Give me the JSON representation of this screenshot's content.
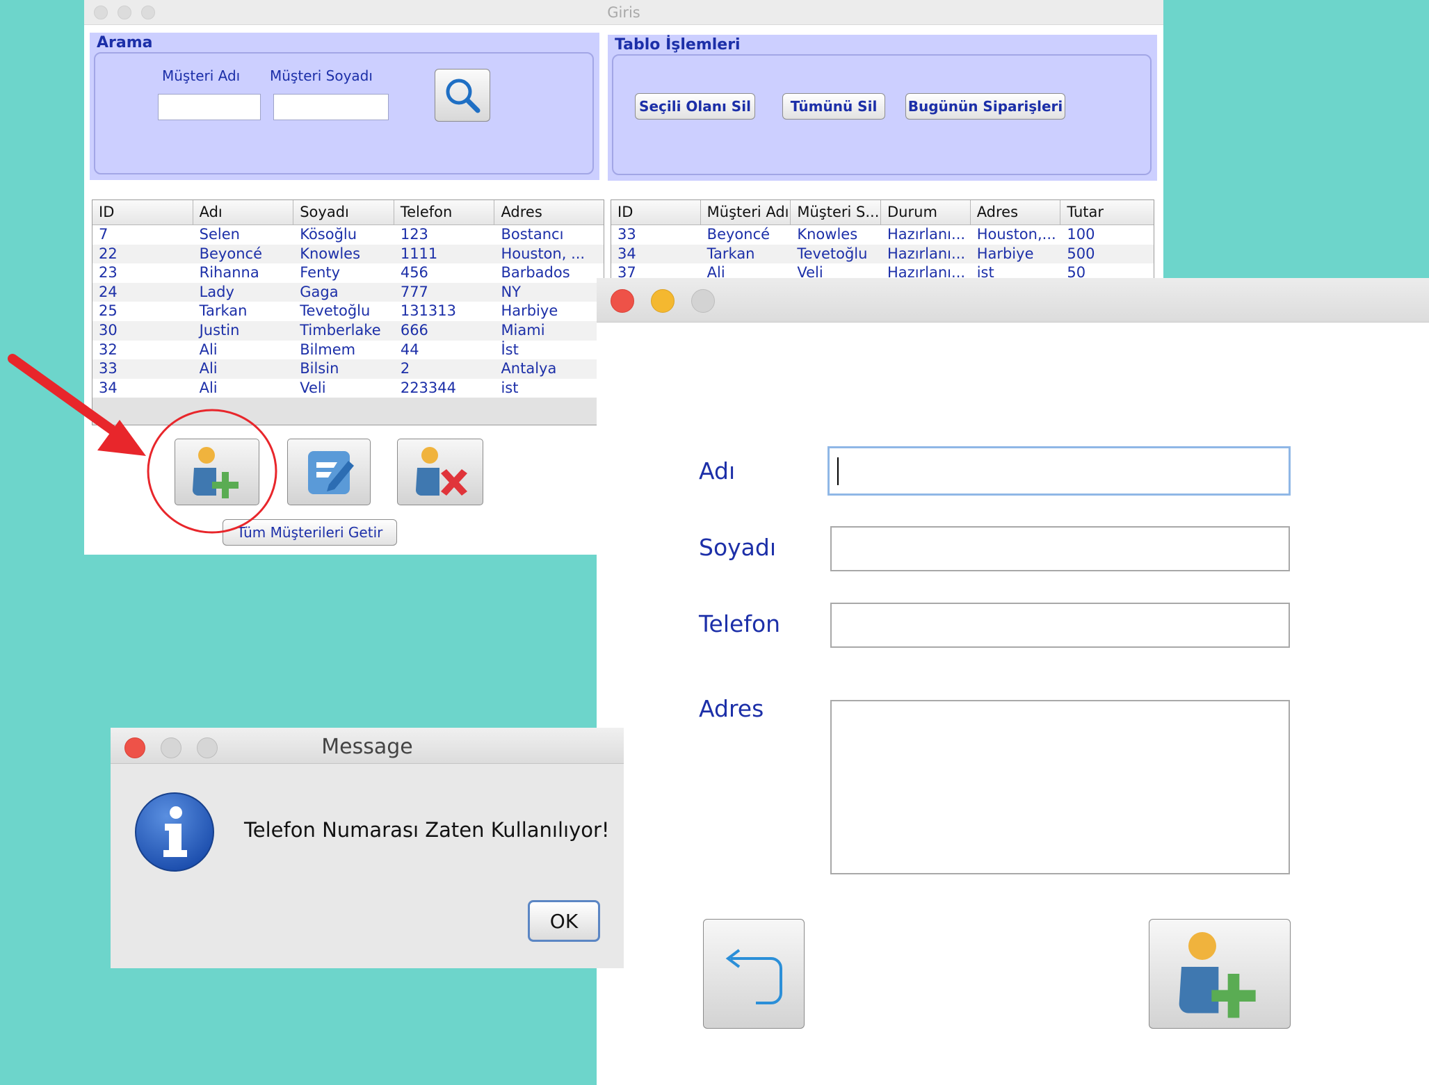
{
  "colors": {
    "background": "#6dd5cb",
    "panel": "#cccfff",
    "label_blue": "#1c2fa8",
    "annotation_red": "#e8262b",
    "close_red": "#ee5248",
    "min_yellow": "#f4b830"
  },
  "main_window": {
    "title": "Giris",
    "search": {
      "title": "Arama",
      "first_name_label": "Müşteri Adı",
      "last_name_label": "Müşteri Soyadı",
      "first_name_value": "",
      "last_name_value": "",
      "search_icon": "magnifier-icon"
    },
    "table_ops": {
      "title": "Tablo İşlemleri",
      "delete_selected": "Seçili Olanı Sil",
      "delete_all": "Tümünü Sil",
      "todays_orders": "Bugünün Siparişleri"
    },
    "customers": {
      "columns": [
        "ID",
        "Adı",
        "Soyadı",
        "Telefon",
        "Adres"
      ],
      "rows": [
        [
          "7",
          "Selen",
          "Kösoğlu",
          "123",
          "Bostancı"
        ],
        [
          "22",
          "Beyoncé",
          "Knowles",
          "1111",
          "Houston, ..."
        ],
        [
          "23",
          "Rihanna",
          "Fenty",
          "456",
          "Barbados"
        ],
        [
          "24",
          "Lady",
          "Gaga",
          "777",
          "NY"
        ],
        [
          "25",
          "Tarkan",
          "Tevetoğlu",
          "131313",
          "Harbiye"
        ],
        [
          "30",
          "Justin",
          "Timberlake",
          "666",
          "Miami"
        ],
        [
          "32",
          "Ali",
          "Bilmem",
          "44",
          "İst"
        ],
        [
          "33",
          "Ali",
          "Bilsin",
          "2",
          "Antalya"
        ],
        [
          "34",
          "Ali",
          "Veli",
          "223344",
          "ist"
        ]
      ]
    },
    "orders": {
      "columns": [
        "ID",
        "Müşteri Adı",
        "Müşteri S...",
        "Durum",
        "Adres",
        "Tutar"
      ],
      "rows": [
        [
          "33",
          "Beyoncé",
          "Knowles",
          "Hazırlanı...",
          "Houston,...",
          "100"
        ],
        [
          "34",
          "Tarkan",
          "Tevetoğlu",
          "Hazırlanı...",
          "Harbiye",
          "500"
        ],
        [
          "37",
          "Ali",
          "Veli",
          "Hazırlanı...",
          "ist",
          "50"
        ]
      ]
    },
    "buttons": {
      "add_icon": "add-user-icon",
      "edit_icon": "edit-icon",
      "delete_icon": "delete-user-icon",
      "get_all": "Tüm Müşterileri Getir"
    }
  },
  "add_dialog": {
    "name_label": "Adı",
    "surname_label": "Soyadı",
    "phone_label": "Telefon",
    "address_label": "Adres",
    "name_value": "",
    "surname_value": "",
    "phone_value": "",
    "address_value": "",
    "back_icon": "back-arrow-icon",
    "save_icon": "add-user-icon"
  },
  "message_dialog": {
    "title": "Message",
    "text": "Telefon Numarası Zaten Kullanılıyor!",
    "ok": "OK",
    "icon": "info-icon"
  }
}
